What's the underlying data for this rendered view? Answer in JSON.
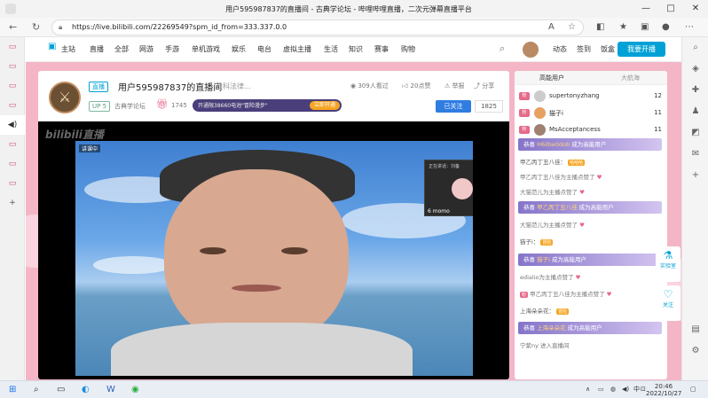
{
  "browser": {
    "tab_title": "用户595987837的直播间 - 古典学论坛 - 哔哩哔哩直播，二次元弹幕直播平台",
    "url": "https://live.bilibili.com/22269549?spm_id_from=333.337.0.0"
  },
  "site_nav": {
    "home": "主站",
    "items": [
      "直播",
      "全部",
      "网游",
      "手游",
      "单机游戏",
      "娱乐",
      "电台",
      "虚拟主播",
      "生活",
      "知识",
      "赛事",
      "购物"
    ],
    "right_items": [
      "动态",
      "签到",
      "饭盒"
    ],
    "start_live": "我要开播"
  },
  "room": {
    "live_tag": "直播",
    "title": "用户595987837的直播间",
    "tagline": "社科法律…",
    "viewers": "309人看过",
    "likes": "20点赞",
    "report": "举报",
    "share": "分享",
    "up_level": "UP 5",
    "area": "古典学论坛",
    "gift_count": "1745",
    "promo_text": "开通限38660电池\"冒险漫步\"",
    "promo_button": "立即开通",
    "follow_button": "已关注",
    "follow_count": "1825"
  },
  "video": {
    "watermark": "bilibili直播",
    "speaker_label": "讲课中",
    "pip_header": "正在讲话：刘备",
    "pip_name": "6 momo"
  },
  "chat": {
    "tabs": [
      "高能用户",
      "大航海"
    ],
    "ranking": [
      {
        "badge": "粉",
        "name": "supertonyzhang",
        "score": "12"
      },
      {
        "badge": "粉",
        "name": "猫子i",
        "score": "11"
      },
      {
        "badge": "粉",
        "name": "MsAcceptancess",
        "score": "11"
      }
    ],
    "messages": [
      {
        "kind": "banner",
        "prefix": "恭喜",
        "user": "H6ilbe0dob",
        "suffix": "成为高能用户"
      },
      {
        "kind": "plain",
        "text": "甲乙丙丁丑八佳：",
        "badge": "哈哈哈"
      },
      {
        "kind": "plain",
        "text": "甲乙丙丁丑八佳为主播点赞了"
      },
      {
        "kind": "plain",
        "text": "大猫范儿为主播点赞了"
      },
      {
        "kind": "banner",
        "prefix": "恭喜",
        "user": "甲乙丙丁丑八佳",
        "suffix": "成为高能用户"
      },
      {
        "kind": "plain",
        "text": "大猫范儿为主播点赞了"
      },
      {
        "kind": "plain",
        "text": "猫子i：",
        "badge": "冒险"
      },
      {
        "kind": "banner",
        "prefix": "恭喜",
        "user": "猫子i",
        "suffix": "成为高能用户"
      },
      {
        "kind": "plain",
        "text": "edialio为主播点赞了"
      },
      {
        "kind": "plain",
        "text": "甲乙丙丁丑八佳为主播点赞了"
      },
      {
        "kind": "plain",
        "text": "上海朵朵花：",
        "badge": "冒险"
      },
      {
        "kind": "banner",
        "prefix": "恭喜",
        "user": "上海朵朵花",
        "suffix": "成为高能用户"
      },
      {
        "kind": "plain",
        "text": "宁紫ny 进入直播间"
      }
    ]
  },
  "float_buttons": [
    "实验室",
    "关注"
  ],
  "taskbar": {
    "time": "20:46",
    "date": "2022/10/27",
    "ime": "中"
  }
}
